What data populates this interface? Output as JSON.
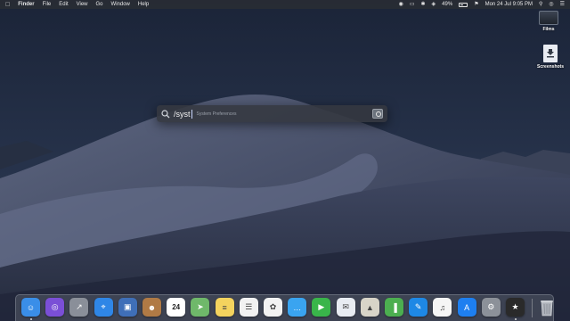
{
  "menubar": {
    "app_name": "Finder",
    "menus": [
      "File",
      "Edit",
      "View",
      "Go",
      "Window",
      "Help"
    ],
    "battery_percent": "49%",
    "clock": "Mon 24 Jul  9:05 PM"
  },
  "desktop_icons": [
    {
      "label": "Films",
      "icon": "folder-icon"
    },
    {
      "label": "Screenshots",
      "icon": "document-icon"
    }
  ],
  "spotlight": {
    "query": "/syst",
    "suggestion": "System Preferences",
    "result_icon": "system-preferences-icon"
  },
  "dock": {
    "apps": [
      {
        "name": "Finder",
        "icon": "finder-icon",
        "color": "#3a8ee8",
        "running": true
      },
      {
        "name": "Siri",
        "icon": "siri-icon",
        "color": "#7a4fd6",
        "running": false
      },
      {
        "name": "Launchpad",
        "icon": "launchpad-icon",
        "color": "#8a8f99",
        "running": false
      },
      {
        "name": "Safari",
        "icon": "safari-icon",
        "color": "#2f86e6",
        "running": false
      },
      {
        "name": "Photo Booth",
        "icon": "photo-icon",
        "color": "#3f6fb8",
        "running": false
      },
      {
        "name": "Contacts",
        "icon": "contacts-icon",
        "color": "#b07a45",
        "running": false
      },
      {
        "name": "Calendar",
        "icon": "calendar-icon",
        "color": "#ffffff",
        "running": false,
        "badge": "24"
      },
      {
        "name": "Maps",
        "icon": "maps-icon",
        "color": "#6fb86a",
        "running": false
      },
      {
        "name": "Notes",
        "icon": "notes-icon",
        "color": "#f4d35e",
        "running": false
      },
      {
        "name": "Reminders",
        "icon": "reminders-icon",
        "color": "#f2f2f2",
        "running": false
      },
      {
        "name": "Photos",
        "icon": "photos-icon",
        "color": "#f2f2f2",
        "running": false
      },
      {
        "name": "Messages",
        "icon": "messages-icon",
        "color": "#3aa4f0",
        "running": false
      },
      {
        "name": "FaceTime",
        "icon": "facetime-icon",
        "color": "#39b54a",
        "running": false
      },
      {
        "name": "Mail",
        "icon": "mail-icon",
        "color": "#e8ecf2",
        "running": false
      },
      {
        "name": "Keynote",
        "icon": "keynote-icon",
        "color": "#d8d4c8",
        "running": false
      },
      {
        "name": "Numbers",
        "icon": "numbers-icon",
        "color": "#4caf50",
        "running": false
      },
      {
        "name": "Pages",
        "icon": "pages-icon",
        "color": "#1e88e5",
        "running": false
      },
      {
        "name": "iTunes",
        "icon": "itunes-icon",
        "color": "#f5f5f5",
        "running": false
      },
      {
        "name": "App Store",
        "icon": "app-store-icon",
        "color": "#1e7ff0",
        "running": false
      },
      {
        "name": "System Preferences",
        "icon": "gear-icon",
        "color": "#8c9199",
        "running": false
      },
      {
        "name": "Final Cut Pro",
        "icon": "final-cut-icon",
        "color": "#2a2a2a",
        "running": true
      }
    ],
    "trash": {
      "name": "Trash",
      "icon": "trash-icon"
    }
  }
}
